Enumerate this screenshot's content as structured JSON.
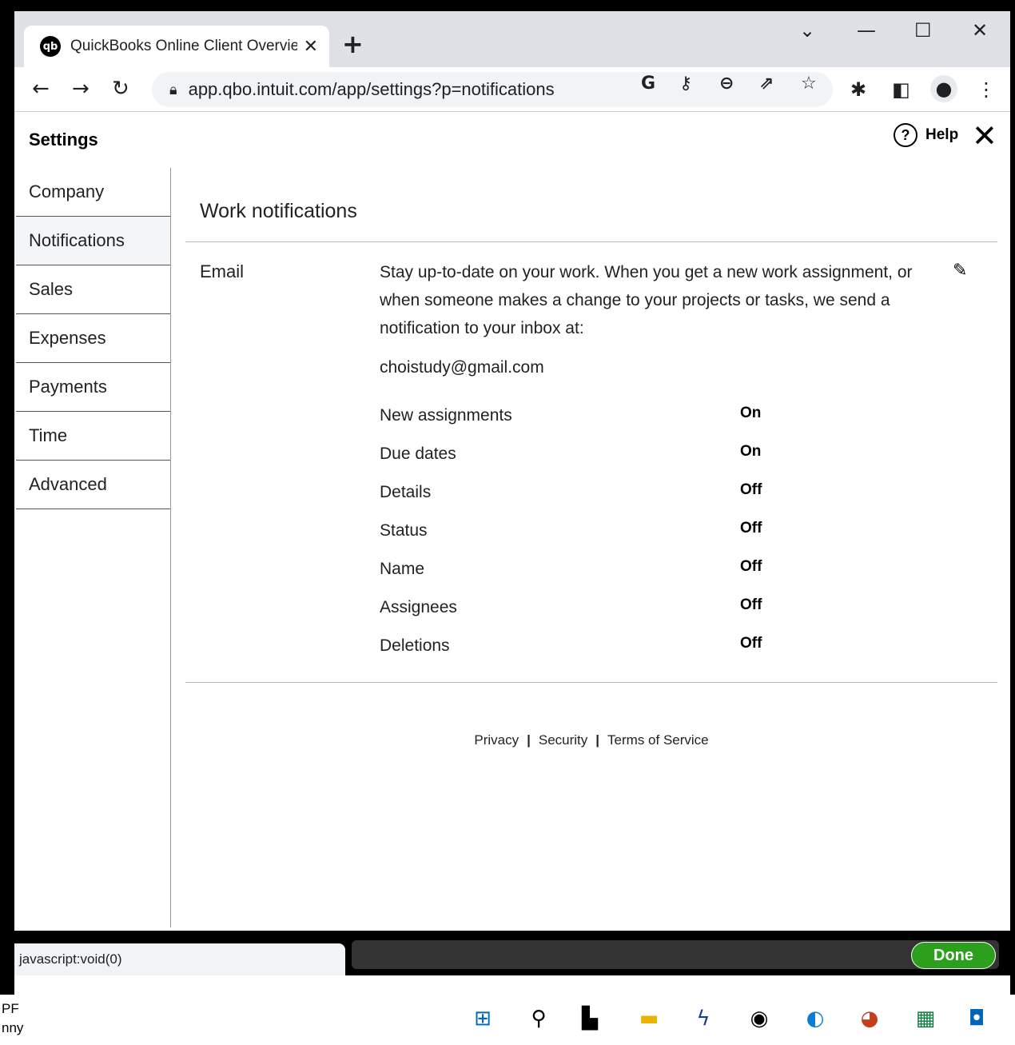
{
  "browser": {
    "tab_title": "QuickBooks Online Client Overvie",
    "tab_favicon": "qb",
    "tab_close": "✕",
    "new_tab": "+",
    "url": "app.qbo.intuit.com/app/settings?p=notifications",
    "omnibox_icons": [
      "google-icon",
      "key-icon",
      "zoom-out-icon",
      "share-icon",
      "star-icon"
    ],
    "toolbar_icons": [
      "extensions-icon",
      "side-panel-icon",
      "profile-icon",
      "menu-icon"
    ]
  },
  "settings": {
    "title": "Settings",
    "help_label": "Help",
    "help_icon": "?",
    "close_glyph": "✕"
  },
  "sidebar": {
    "items": [
      {
        "label": "Company"
      },
      {
        "label": "Notifications",
        "active": true
      },
      {
        "label": "Sales"
      },
      {
        "label": "Expenses"
      },
      {
        "label": "Payments"
      },
      {
        "label": "Time"
      },
      {
        "label": "Advanced"
      }
    ]
  },
  "main": {
    "section_title": "Work notifications",
    "email_label": "Email",
    "description": "Stay up-to-date on your work. When you get a new work assignment, or when someone makes a change to your projects or tasks, we send a notification to your inbox at:",
    "email_address": "choistudy@gmail.com",
    "settings": [
      {
        "name": "New assignments",
        "value": "On"
      },
      {
        "name": "Due dates",
        "value": "On"
      },
      {
        "name": "Details",
        "value": "Off"
      },
      {
        "name": "Status",
        "value": "Off"
      },
      {
        "name": "Name",
        "value": "Off"
      },
      {
        "name": "Assignees",
        "value": "Off"
      },
      {
        "name": "Deletions",
        "value": "Off"
      }
    ]
  },
  "footer": {
    "privacy": "Privacy",
    "security": "Security",
    "terms": "Terms of Service",
    "separator": "|"
  },
  "statusbar": {
    "status_text": "javascript:void(0)",
    "done_label": "Done"
  },
  "taskbar": {
    "left_line1": "PF",
    "left_line2": "nny"
  }
}
